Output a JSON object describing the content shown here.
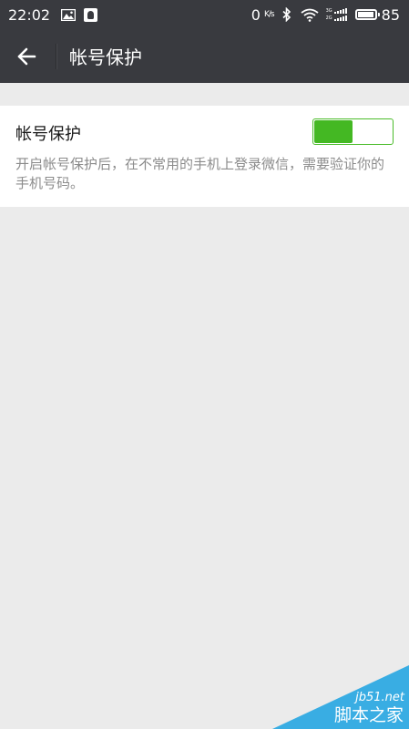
{
  "status_bar": {
    "time": "22:02",
    "net_speed": "0",
    "net_unit": "K/s",
    "sim1_label": "3G",
    "sim2_label": "2G",
    "battery_level": 85,
    "battery_text": "85",
    "icons": [
      "image-icon",
      "qq-icon",
      "bluetooth-icon",
      "wifi-icon",
      "signal-icon",
      "battery-icon"
    ]
  },
  "nav": {
    "back_icon": "back-arrow-icon",
    "title": "帐号保护"
  },
  "setting": {
    "label": "帐号保护",
    "enabled": true,
    "description": "开启帐号保护后，在不常用的手机上登录微信，需要验证你的手机号码。"
  },
  "colors": {
    "status_bar_bg": "#393a3f",
    "nav_bg": "#393a3f",
    "page_bg": "#ebebeb",
    "toggle_green": "#44b823",
    "watermark_blue": "#29a7e1"
  },
  "watermark": {
    "site": "jb51.net",
    "name": "脚本之家"
  }
}
